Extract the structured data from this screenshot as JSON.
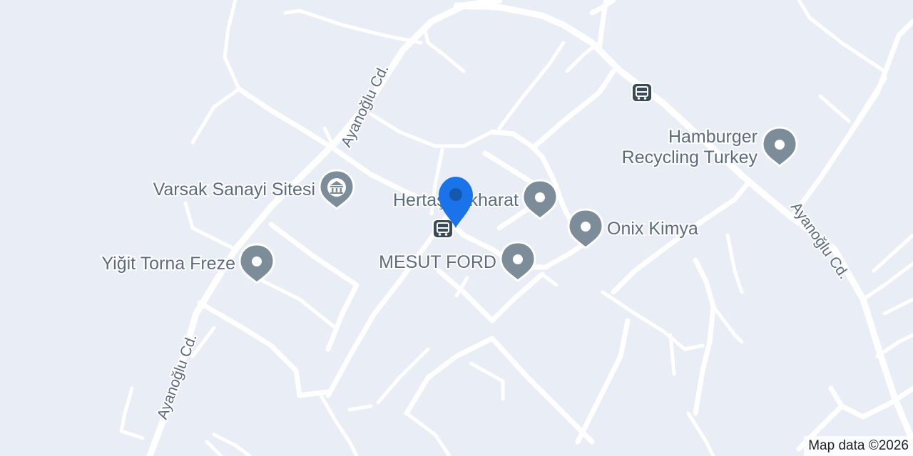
{
  "places": {
    "varsak": "Varsak Sanayi Sitesi",
    "yigit": "Yiğit Torna Freze",
    "herta": "Hertaş Tekharat",
    "mesut": "MESUT FORD",
    "onix": "Onix Kimya",
    "hamburger_line1": "Hamburger",
    "hamburger_line2": "Recycling Turkey"
  },
  "roads": {
    "ayanoglu_1": "Ayanoğlu Cd.",
    "ayanoglu_2": "Ayanoğlu Cd.",
    "ayanoglu_3": "Ayanoğlu Cd."
  },
  "icons": {
    "place_pin": "place-pin-icon",
    "building": "building-icon",
    "bus": "bus-stop-icon",
    "location": "location-marker-icon"
  },
  "colors": {
    "background": "#e9edf6",
    "road": "#ffffff",
    "label": "#5b6b82",
    "pin": "#7d8c99",
    "bus": "#3a4a5a",
    "marker": "#1a73e8"
  },
  "attribution": "Map data ©2026"
}
